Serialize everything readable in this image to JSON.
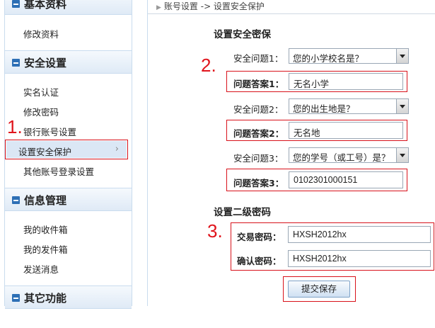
{
  "sidebar": {
    "sections": [
      {
        "title": "基本资料",
        "items": [
          "修改资料"
        ]
      },
      {
        "title": "安全设置",
        "items": [
          "实名认证",
          "修改密码",
          "银行账号设置",
          "设置安全保护",
          "其他账号登录设置"
        ]
      },
      {
        "title": "信息管理",
        "items": [
          "我的收件箱",
          "我的发件箱",
          "发送消息"
        ]
      },
      {
        "title": "其它功能",
        "items": []
      }
    ],
    "active_chevron": "›"
  },
  "breadcrumb": "账号设置 -> 设置安全保护",
  "security_questions": {
    "title": "设置安全密保",
    "rows": [
      {
        "question_label": "安全问题1：",
        "question_value": "您的小学校名是？",
        "answer_label": "问题答案1：",
        "answer_value": "无名小学"
      },
      {
        "question_label": "安全问题2：",
        "question_value": "您的出生地是？",
        "answer_label": "问题答案2：",
        "answer_value": "无名地"
      },
      {
        "question_label": "安全问题3：",
        "question_value": "您的学号（或工号）是？",
        "answer_label": "问题答案3：",
        "answer_value": "0102301000151"
      }
    ]
  },
  "secondary_password": {
    "title": "设置二级密码",
    "trade_label": "交易密码：",
    "trade_value": "HXSH2012hx",
    "confirm_label": "确认密码：",
    "confirm_value": "HXSH2012hx"
  },
  "submit_label": "提交保存",
  "steps": [
    "1.",
    "2.",
    "3."
  ],
  "colors": {
    "annotation_red": "#d8121b",
    "nav_active_bg": "#dbe7f5",
    "header_blue": "#2d6fb5"
  },
  "icons": [
    "minus-square-icon",
    "chevron-right-icon",
    "dropdown-arrow-icon",
    "breadcrumb-triangle-icon"
  ]
}
